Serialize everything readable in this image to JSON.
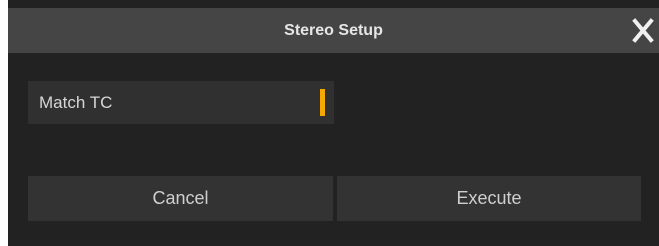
{
  "dialog": {
    "title": "Stereo Setup",
    "close_icon": "close-icon"
  },
  "option": {
    "label": "Match TC",
    "indicator_color": "#f5a800"
  },
  "actions": {
    "cancel_label": "Cancel",
    "execute_label": "Execute"
  }
}
